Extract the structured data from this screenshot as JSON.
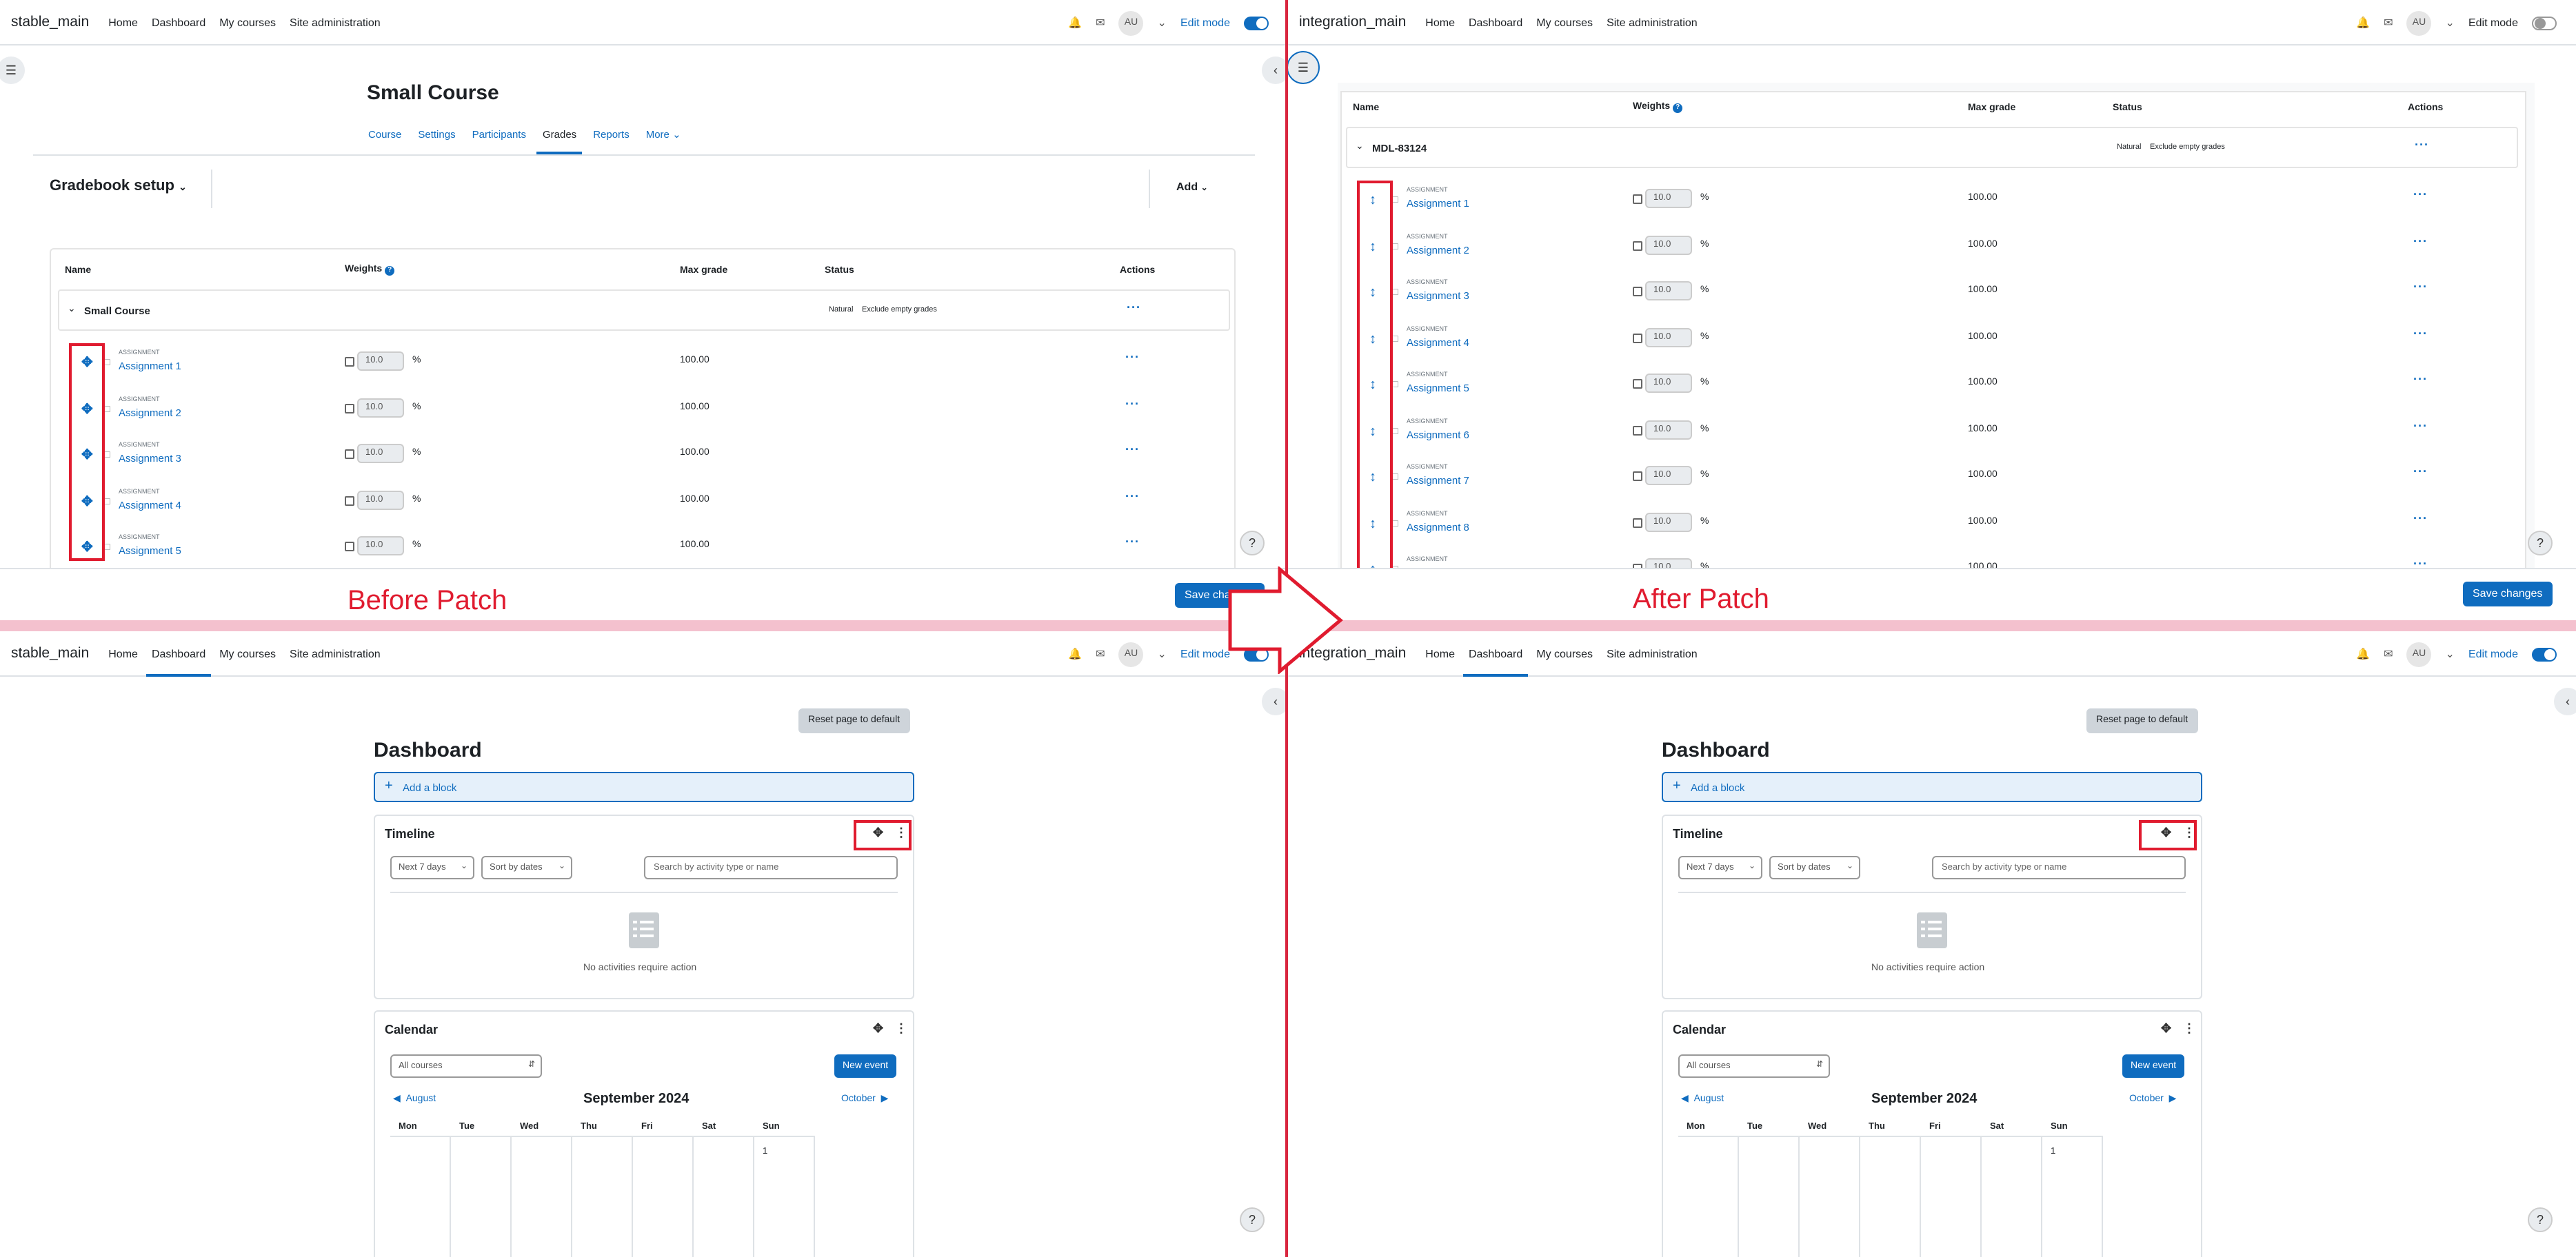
{
  "annotations": {
    "before_label": "Before Patch",
    "after_label": "After Patch"
  },
  "before": {
    "gradebook": {
      "brand": "stable_main",
      "nav": [
        "Home",
        "Dashboard",
        "My courses",
        "Site administration"
      ],
      "avatar": "AU",
      "edit_mode_label": "Edit mode",
      "edit_mode_on": true,
      "course_title": "Small Course",
      "tabs": [
        "Course",
        "Settings",
        "Participants",
        "Grades",
        "Reports",
        "More"
      ],
      "active_tab": "Grades",
      "gradebook_title": "Gradebook setup",
      "add_label": "Add",
      "columns": [
        "Name",
        "Weights",
        "Max grade",
        "Status",
        "Actions"
      ],
      "category": {
        "name": "Small Course",
        "status": [
          "Natural",
          "Exclude empty grades"
        ]
      },
      "items": [
        {
          "type": "ASSIGNMENT",
          "name": "Assignment 1",
          "weight": "10.0",
          "max": "100.00"
        },
        {
          "type": "ASSIGNMENT",
          "name": "Assignment 2",
          "weight": "10.0",
          "max": "100.00"
        },
        {
          "type": "ASSIGNMENT",
          "name": "Assignment 3",
          "weight": "10.0",
          "max": "100.00"
        },
        {
          "type": "ASSIGNMENT",
          "name": "Assignment 4",
          "weight": "10.0",
          "max": "100.00"
        },
        {
          "type": "ASSIGNMENT",
          "name": "Assignment 5",
          "weight": "10.0",
          "max": "100.00"
        }
      ],
      "pct": "%",
      "save_label": "Save changes",
      "help": "?"
    },
    "dashboard": {
      "brand": "stable_main",
      "nav": [
        "Home",
        "Dashboard",
        "My courses",
        "Site administration"
      ],
      "active_nav": "Dashboard",
      "avatar": "AU",
      "edit_mode_label": "Edit mode",
      "reset_label": "Reset page to default",
      "title": "Dashboard",
      "add_block_label": "Add a block",
      "timeline": {
        "title": "Timeline",
        "range": "Next 7 days",
        "sort": "Sort by dates",
        "search_placeholder": "Search by activity type or name",
        "empty": "No activities require action"
      },
      "calendar": {
        "title": "Calendar",
        "course_filter": "All courses",
        "new_event": "New event",
        "prev": "August",
        "month": "September 2024",
        "next": "October",
        "days": [
          "Mon",
          "Tue",
          "Wed",
          "Thu",
          "Fri",
          "Sat",
          "Sun"
        ],
        "first_day": "1"
      },
      "help": "?"
    }
  },
  "after": {
    "gradebook": {
      "brand": "integration_main",
      "nav": [
        "Home",
        "Dashboard",
        "My courses",
        "Site administration"
      ],
      "avatar": "AU",
      "edit_mode_label": "Edit mode",
      "edit_mode_on": false,
      "columns": [
        "Name",
        "Weights",
        "Max grade",
        "Status",
        "Actions"
      ],
      "category": {
        "name": "MDL-83124",
        "status": [
          "Natural",
          "Exclude empty grades"
        ]
      },
      "items": [
        {
          "type": "ASSIGNMENT",
          "name": "Assignment 1",
          "weight": "10.0",
          "max": "100.00"
        },
        {
          "type": "ASSIGNMENT",
          "name": "Assignment 2",
          "weight": "10.0",
          "max": "100.00"
        },
        {
          "type": "ASSIGNMENT",
          "name": "Assignment 3",
          "weight": "10.0",
          "max": "100.00"
        },
        {
          "type": "ASSIGNMENT",
          "name": "Assignment 4",
          "weight": "10.0",
          "max": "100.00"
        },
        {
          "type": "ASSIGNMENT",
          "name": "Assignment 5",
          "weight": "10.0",
          "max": "100.00"
        },
        {
          "type": "ASSIGNMENT",
          "name": "Assignment 6",
          "weight": "10.0",
          "max": "100.00"
        },
        {
          "type": "ASSIGNMENT",
          "name": "Assignment 7",
          "weight": "10.0",
          "max": "100.00"
        },
        {
          "type": "ASSIGNMENT",
          "name": "Assignment 8",
          "weight": "10.0",
          "max": "100.00"
        },
        {
          "type": "ASSIGNMENT",
          "name": "",
          "weight": "10.0",
          "max": "100.00"
        }
      ],
      "pct": "%",
      "save_label": "Save changes",
      "help": "?"
    },
    "dashboard": {
      "brand": "integration_main",
      "nav": [
        "Home",
        "Dashboard",
        "My courses",
        "Site administration"
      ],
      "active_nav": "Dashboard",
      "avatar": "AU",
      "edit_mode_label": "Edit mode",
      "reset_label": "Reset page to default",
      "title": "Dashboard",
      "add_block_label": "Add a block",
      "timeline": {
        "title": "Timeline",
        "range": "Next 7 days",
        "sort": "Sort by dates",
        "search_placeholder": "Search by activity type or name",
        "empty": "No activities require action"
      },
      "calendar": {
        "title": "Calendar",
        "course_filter": "All courses",
        "new_event": "New event",
        "prev": "August",
        "month": "September 2024",
        "next": "October",
        "days": [
          "Mon",
          "Tue",
          "Wed",
          "Thu",
          "Fri",
          "Sat",
          "Sun"
        ],
        "first_day": "1"
      },
      "help": "?"
    }
  }
}
